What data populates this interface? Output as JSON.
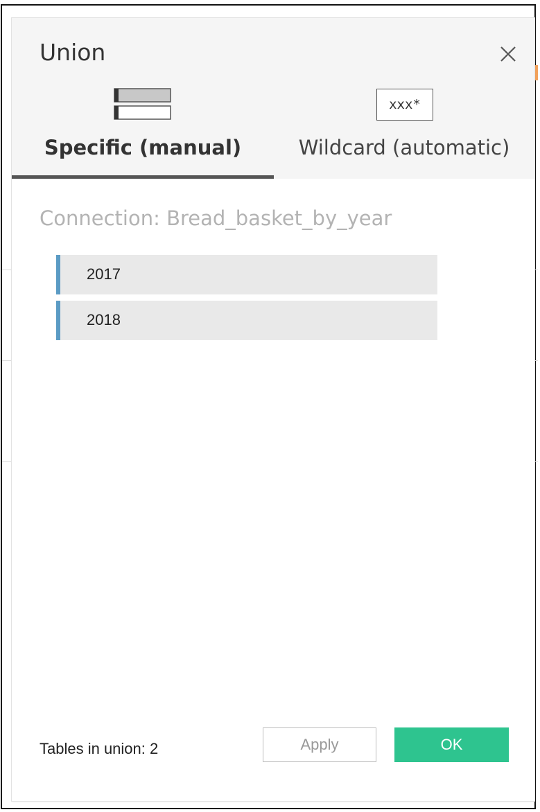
{
  "dialog": {
    "title": "Union",
    "close_icon": "close-icon"
  },
  "tabs": [
    {
      "label": "Specific (manual)",
      "icon": "specific-tables-icon",
      "active": true
    },
    {
      "label": "Wildcard (automatic)",
      "icon": "wildcard-icon",
      "icon_text": "xxx*",
      "active": false
    }
  ],
  "connection": {
    "label": "Connection: Bread_basket_by_year"
  },
  "tables": [
    {
      "name": "2017"
    },
    {
      "name": "2018"
    }
  ],
  "footer": {
    "tables_in_union": "Tables in union: 2",
    "apply_label": "Apply",
    "ok_label": "OK"
  },
  "colors": {
    "ok_button": "#2ec48f",
    "table_accent": "#5b9bc4",
    "active_tab_underline": "#555555"
  }
}
